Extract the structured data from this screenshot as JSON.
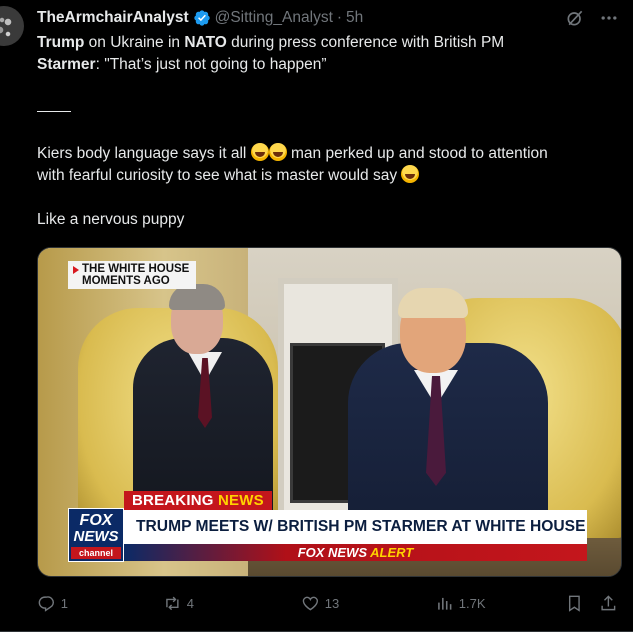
{
  "author": {
    "display_name": "TheArmchairAnalyst",
    "handle": "@Sitting_Analyst",
    "separator": "·",
    "time": "5h"
  },
  "tweet": {
    "line1_b1": "Trump",
    "line1_t1": " on Ukraine in ",
    "line1_b2": "NATO",
    "line1_t2": " during press conference with British PM",
    "line2_b1": "Starmer",
    "line2_t1": ": \"That’s just not going to happen”",
    "para2_part1": "Kiers body language says it all ",
    "para2_part2": " man perked up and stood to attention",
    "para2_line2": "with fearful curiosity to see what is master would say ",
    "para3": "Like a nervous puppy"
  },
  "media": {
    "tag_text": "THE WHITE HOUSE MOMENTS AGO",
    "breaking_part1": "BREAKING ",
    "breaking_part2": "NEWS",
    "headline": "TRUMP MEETS W/ BRITISH PM STARMER AT WHITE HOUSE",
    "alert_part1": "FOX NEWS ",
    "alert_part2": "ALERT",
    "logo_line1": "FOX",
    "logo_line2": "NEWS",
    "logo_line3": "channel"
  },
  "actions": {
    "replies": "1",
    "reposts": "4",
    "likes": "13",
    "views": "1.7K"
  },
  "icons": {
    "verified": "verified-badge-icon",
    "grok": "grok-icon",
    "more": "more-icon",
    "reply": "reply-icon",
    "repost": "repost-icon",
    "like": "heart-icon",
    "views": "views-icon",
    "bookmark": "bookmark-icon",
    "share": "share-icon"
  },
  "colors": {
    "background": "#000000",
    "text": "#e7e9ea",
    "muted": "#71767b",
    "verified": "#1d9bf0"
  }
}
